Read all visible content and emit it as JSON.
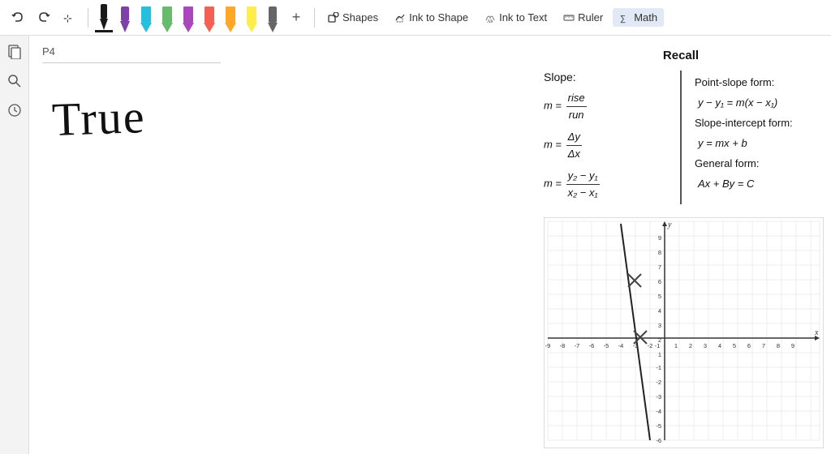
{
  "toolbar": {
    "undo_label": "↩",
    "redo_label": "↪",
    "select_label": "⊹",
    "eraser_label": "◻",
    "shapes_label": "Shapes",
    "ink_to_shape_label": "Ink to Shape",
    "ink_to_text_label": "Ink to Text",
    "ruler_label": "Ruler",
    "math_label": "Math",
    "add_label": "+"
  },
  "sidebar": {
    "pages_icon": "▣",
    "search_icon": "🔍",
    "history_icon": "🕐"
  },
  "page": {
    "label": "P4",
    "handwriting": "True"
  },
  "recall": {
    "title": "Recall",
    "slope_label": "Slope:",
    "formula1_m": "m =",
    "formula1_num": "rise",
    "formula1_den": "run",
    "formula2_m": "m =",
    "formula2_num": "Δy",
    "formula2_den": "Δx",
    "formula3_m": "m =",
    "formula3_num": "y₂ − y₁",
    "formula3_den": "x₂ − x₁",
    "point_slope_label": "Point-slope form:",
    "point_slope_formula": "y − y₁ = m(x − x₁)",
    "slope_intercept_label": "Slope-intercept form:",
    "slope_intercept_formula": "y = mx + b",
    "general_label": "General form:",
    "general_formula": "Ax + By = C"
  },
  "graph": {
    "x_min": -9,
    "x_max": 9,
    "y_min": -6,
    "y_max": 9,
    "x_label": "x",
    "y_label": "y"
  },
  "pens": [
    {
      "color": "#7e3fa8",
      "type": "marker"
    },
    {
      "color": "#1a1a1a",
      "type": "pen",
      "active": true
    },
    {
      "color": "#00b4d8",
      "type": "highlighter"
    },
    {
      "color": "#4caf50",
      "type": "highlighter"
    },
    {
      "color": "#9c27b0",
      "type": "highlighter"
    },
    {
      "color": "#f44336",
      "type": "highlighter"
    },
    {
      "color": "#ff9800",
      "type": "highlighter"
    },
    {
      "color": "#ffeb3b",
      "type": "highlighter"
    },
    {
      "color": "#555555",
      "type": "marker2"
    }
  ]
}
